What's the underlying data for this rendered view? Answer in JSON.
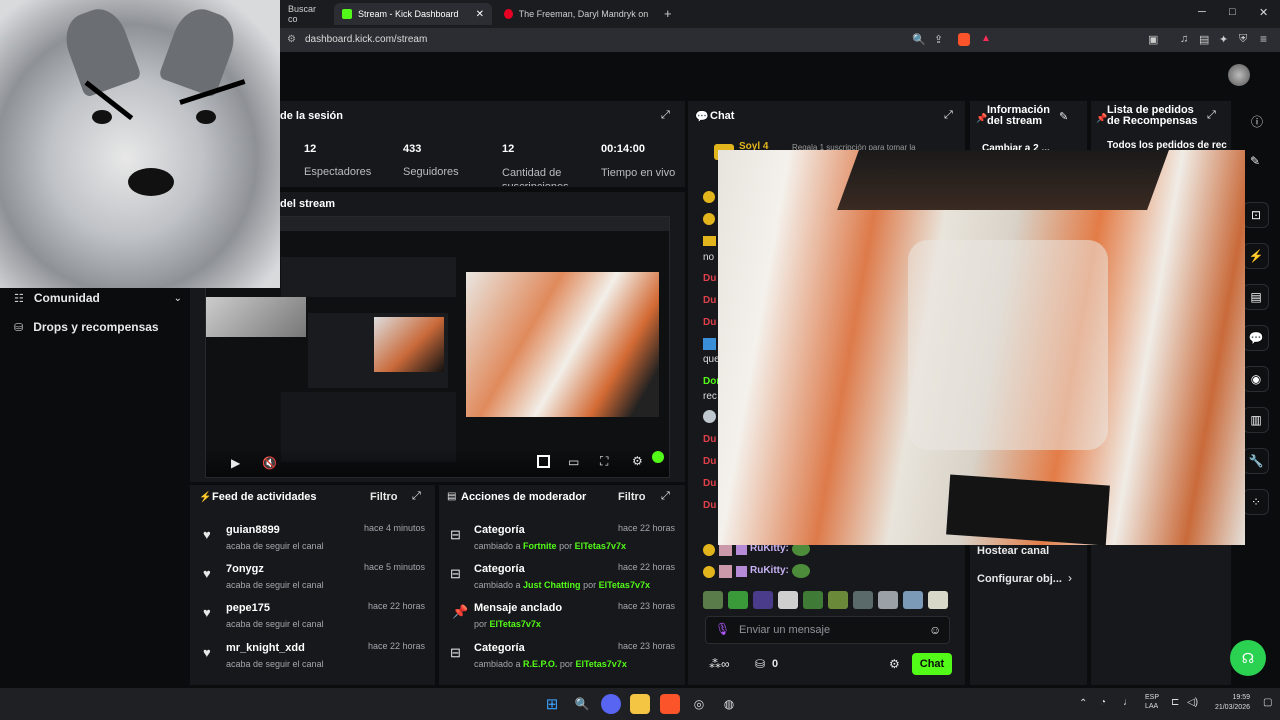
{
  "browser": {
    "tabs": [
      {
        "label": "Buscar co"
      },
      {
        "label": "Stream - Kick Dashboard"
      },
      {
        "label": "The Freeman, Daryl Mandryk on ArtS"
      }
    ],
    "url": "dashboard.kick.com/stream",
    "new_tab": "+",
    "win_min": "─",
    "win_max": "□",
    "win_close": "✕"
  },
  "session": {
    "title": "de la sesión",
    "stats": [
      {
        "value": "12",
        "label": "Espectadores"
      },
      {
        "value": "433",
        "label": "Seguidores"
      },
      {
        "value": "12",
        "label": "Cantidad de suscripciones"
      },
      {
        "value": "00:14:00",
        "label": "Tiempo en vivo"
      }
    ]
  },
  "preview": {
    "title": "del stream"
  },
  "sidebar": {
    "items": [
      {
        "label": "Comunidad"
      },
      {
        "label": "Drops y recompensas"
      }
    ]
  },
  "feed": {
    "title": "Feed de actividades",
    "filter": "Filtro",
    "items": [
      {
        "name": "guian8899",
        "sub": "acaba de seguir el canal",
        "time": "hace 4 minutos"
      },
      {
        "name": "7onygz",
        "sub": "acaba de seguir el canal",
        "time": "hace 5 minutos"
      },
      {
        "name": "pepe175",
        "sub": "acaba de seguir el canal",
        "time": "hace 22 horas"
      },
      {
        "name": "mr_knight_xdd",
        "sub": "acaba de seguir el canal",
        "time": "hace 22 horas"
      }
    ]
  },
  "modactions": {
    "title": "Acciones de moderador",
    "filter": "Filtro",
    "items": [
      {
        "title": "Categoría",
        "pre": "cambiado a",
        "target": "Fortnite",
        "by": "por",
        "user": "ElTetas7v7x",
        "time": "hace 22 horas"
      },
      {
        "title": "Categoría",
        "pre": "cambiado a",
        "target": "Just Chatting",
        "by": "por",
        "user": "ElTetas7v7x",
        "time": "hace 22 horas"
      },
      {
        "title": "Mensaje anclado",
        "pre": "por",
        "target": "",
        "by": "",
        "user": "ElTetas7v7x",
        "time": "hace 23 horas"
      },
      {
        "title": "Categoría",
        "pre": "cambiado a",
        "target": "R.E.P.O.",
        "by": "por",
        "user": "ElTetas7v7x",
        "time": "hace 23 horas"
      }
    ]
  },
  "chat": {
    "title": "Chat",
    "top_user": "Soyl 4",
    "top_text": "Regala 1 suscripción para tomar la",
    "fragments": [
      "no",
      "Du",
      "Du",
      "Du",
      "que",
      "Dor",
      "rec",
      "Du",
      "Du",
      "Du",
      "Du"
    ],
    "messages": [
      {
        "user": "RuKitty:"
      },
      {
        "user": "RuKitty:"
      }
    ],
    "input_placeholder": "Enviar un mensaje",
    "count": "0",
    "send": "Chat"
  },
  "info": {
    "title": "Información del stream",
    "subtitle": "Cambiar a 2 ...",
    "host": "Hostear canal",
    "config": "Configurar obj..."
  },
  "rewards": {
    "title": "Lista de pedidos de Recompensas",
    "all": "Todos los pedidos de rec"
  },
  "taskbar": {
    "lang1": "ESP",
    "lang2": "LAA",
    "time": "19:59",
    "date": "21/03/2026"
  },
  "colors": {
    "accent": "#53fc18",
    "panel": "#17181c",
    "bg": "#0b0c0e"
  }
}
